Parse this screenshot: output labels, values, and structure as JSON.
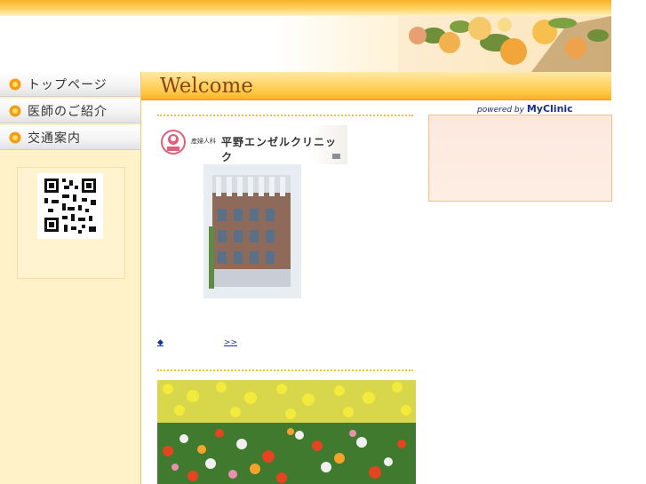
{
  "nav": {
    "items": [
      {
        "label": "トップページ"
      },
      {
        "label": "医師のご紹介"
      },
      {
        "label": "交通案内"
      }
    ]
  },
  "main": {
    "welcome": "Welcome",
    "clinic_prefix": "産婦人科",
    "clinic_name": "平野エンゼルクリニック",
    "more_link": {
      "bullet": "◆",
      "arrow": ">>"
    }
  },
  "widget": {
    "powered_by": "powered by",
    "brand": "MyClinic"
  },
  "colors": {
    "accent": "#f7b22b",
    "sidebar_bg": "#fff2c9",
    "link": "#1a2fb0",
    "welcome_text": "#8b4513"
  },
  "icons": [
    "flower-bullet-icon",
    "qr-code-icon",
    "clinic-logo-icon"
  ]
}
